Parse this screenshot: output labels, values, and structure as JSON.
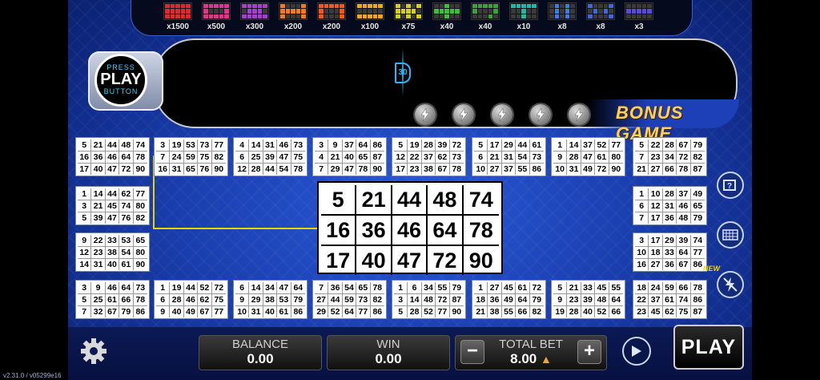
{
  "paytable": [
    {
      "mult": "x1500",
      "color": "#e0282f",
      "pattern": "1111111111111111111111111"
    },
    {
      "mult": "x500",
      "color": "#e0358f",
      "pattern": "111111000111111"
    },
    {
      "mult": "x300",
      "color": "#a53ed3",
      "pattern": "111110111011111"
    },
    {
      "mult": "x200",
      "color": "#f07c1d",
      "pattern": "100011111110001"
    },
    {
      "mult": "x200",
      "color": "#f05a14",
      "pattern": "111111000110001"
    },
    {
      "mult": "x100",
      "color": "#f5a51a",
      "pattern": "111110000011111"
    },
    {
      "mult": "x75",
      "color": "#d6d01b",
      "pattern": "101011111010101"
    },
    {
      "mult": "x40",
      "color": "#3dbf3a",
      "pattern": "001001111100100"
    },
    {
      "mult": "x40",
      "color": "#37a43a",
      "pattern": "111111000100010"
    },
    {
      "mult": "x10",
      "color": "#1bb9a8",
      "pattern": "111110010000100"
    },
    {
      "mult": "x8",
      "color": "#3a7fe0",
      "pattern": "010100101001010"
    },
    {
      "mult": "x8",
      "color": "#3d68e0",
      "pattern": "100010101010001"
    },
    {
      "mult": "x3",
      "color": "#5a4ad8",
      "pattern": "000001111100000"
    }
  ],
  "press_play": {
    "top": "PRESS",
    "main": "PLAY",
    "bottom": "BUTTON"
  },
  "ball_counter": "30",
  "bonus_label": "BONUS GAME",
  "cards": [
    {
      "nums": [
        5,
        21,
        44,
        48,
        74,
        16,
        36,
        46,
        64,
        78,
        17,
        40,
        47,
        72,
        90
      ]
    },
    {
      "nums": [
        3,
        19,
        53,
        73,
        77,
        7,
        24,
        59,
        75,
        82,
        16,
        31,
        65,
        76,
        90
      ]
    },
    {
      "nums": [
        4,
        14,
        31,
        46,
        73,
        6,
        25,
        39,
        47,
        75,
        12,
        28,
        44,
        54,
        78
      ]
    },
    {
      "nums": [
        3,
        9,
        37,
        64,
        86,
        4,
        21,
        40,
        65,
        87,
        7,
        29,
        47,
        78,
        90
      ]
    },
    {
      "nums": [
        5,
        19,
        28,
        39,
        72,
        12,
        22,
        37,
        62,
        73,
        17,
        23,
        38,
        67,
        78
      ]
    },
    {
      "nums": [
        5,
        17,
        29,
        44,
        61,
        6,
        21,
        31,
        54,
        73,
        10,
        27,
        37,
        55,
        86
      ]
    },
    {
      "nums": [
        1,
        14,
        37,
        52,
        77,
        9,
        28,
        47,
        61,
        80,
        10,
        31,
        49,
        72,
        90
      ]
    },
    {
      "nums": [
        5,
        22,
        28,
        67,
        79,
        7,
        23,
        34,
        72,
        82,
        21,
        27,
        66,
        78,
        87
      ]
    },
    {
      "nums": [
        1,
        14,
        44,
        62,
        77,
        3,
        21,
        45,
        74,
        80,
        5,
        39,
        47,
        76,
        82
      ]
    },
    {
      "nums": [
        1,
        10,
        28,
        37,
        49,
        6,
        12,
        31,
        46,
        65,
        7,
        17,
        36,
        48,
        79
      ]
    },
    {
      "nums": [
        9,
        22,
        33,
        53,
        65,
        12,
        23,
        38,
        54,
        80,
        14,
        31,
        40,
        61,
        90
      ]
    },
    {
      "nums": [
        3,
        17,
        29,
        39,
        74,
        10,
        18,
        33,
        64,
        77,
        16,
        27,
        36,
        67,
        86
      ]
    },
    {
      "nums": [
        3,
        9,
        46,
        64,
        73,
        5,
        25,
        61,
        66,
        78,
        7,
        32,
        67,
        79,
        86
      ]
    },
    {
      "nums": [
        1,
        19,
        44,
        52,
        72,
        6,
        28,
        46,
        62,
        75,
        9,
        40,
        49,
        67,
        77
      ]
    },
    {
      "nums": [
        6,
        14,
        34,
        47,
        64,
        9,
        29,
        38,
        53,
        79,
        10,
        31,
        40,
        61,
        86
      ]
    },
    {
      "nums": [
        7,
        36,
        54,
        65,
        78,
        27,
        44,
        59,
        73,
        82,
        29,
        52,
        64,
        77,
        86
      ]
    },
    {
      "nums": [
        1,
        6,
        34,
        55,
        79,
        3,
        14,
        48,
        72,
        87,
        5,
        28,
        52,
        77,
        90
      ]
    },
    {
      "nums": [
        1,
        27,
        45,
        61,
        72,
        18,
        36,
        49,
        64,
        79,
        21,
        38,
        55,
        66,
        82
      ]
    },
    {
      "nums": [
        5,
        21,
        33,
        45,
        55,
        9,
        23,
        39,
        48,
        64,
        19,
        28,
        40,
        52,
        66
      ]
    },
    {
      "nums": [
        18,
        24,
        59,
        66,
        78,
        22,
        37,
        61,
        74,
        86,
        23,
        45,
        62,
        75,
        87
      ]
    }
  ],
  "big_card": [
    5,
    21,
    44,
    48,
    74,
    16,
    36,
    46,
    64,
    78,
    17,
    40,
    47,
    72,
    90
  ],
  "new_badge": "NEW",
  "bottom": {
    "balance_label": "BALANCE",
    "balance_value": "0.00",
    "win_label": "WIN",
    "win_value": "0.00",
    "total_bet_label": "TOTAL BET",
    "total_bet_value": "8.00",
    "minus": "−",
    "plus": "+",
    "play_label": "PLAY"
  },
  "version": "v2.31.0 / v05299e16"
}
